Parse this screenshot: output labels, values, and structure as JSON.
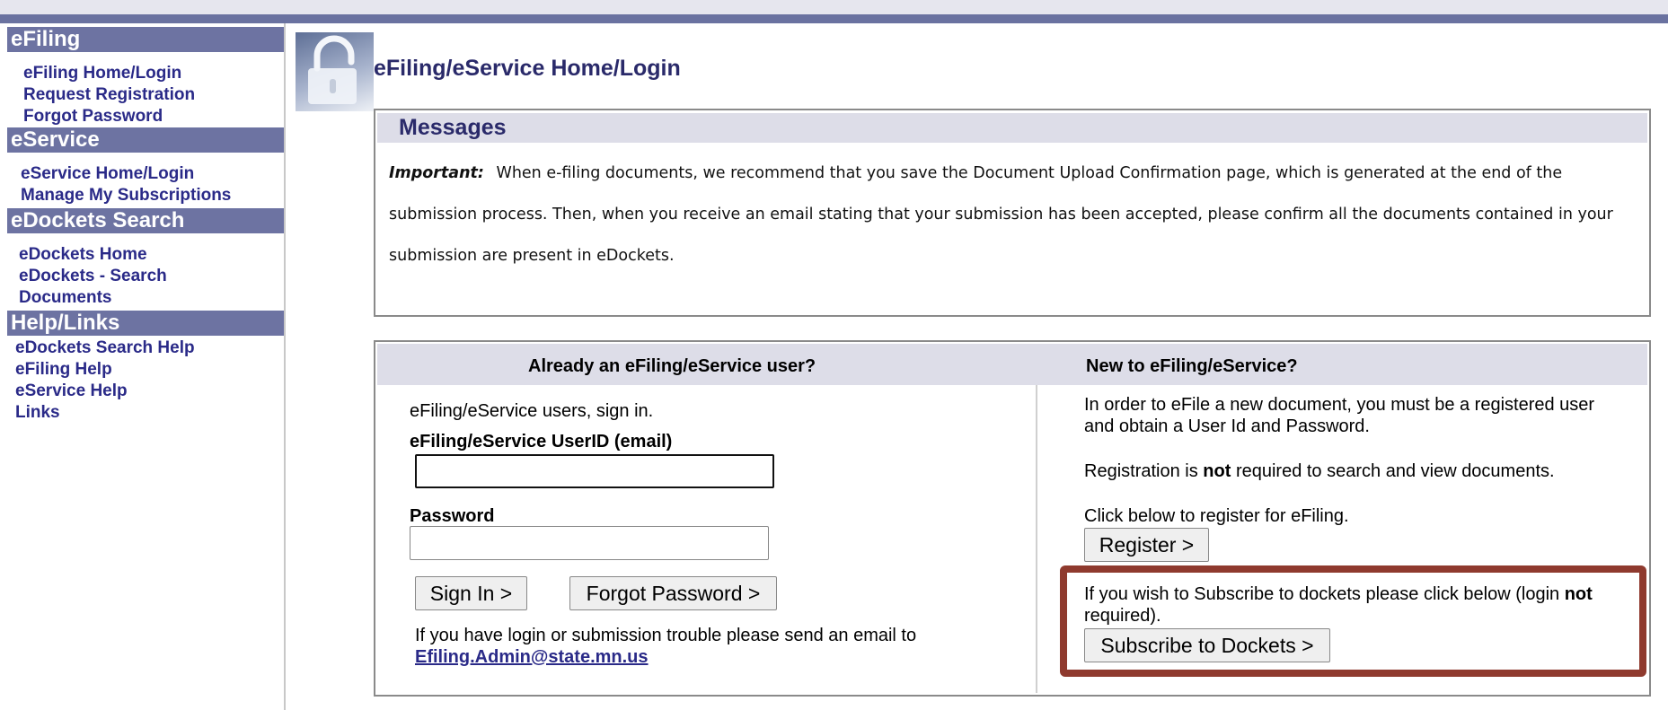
{
  "sidebar": {
    "efiling": {
      "heading": "eFiling",
      "links": [
        "eFiling Home/Login",
        "Request Registration",
        "Forgot Password"
      ]
    },
    "eservice": {
      "heading": "eService",
      "links": [
        "eService Home/Login",
        "Manage My Subscriptions"
      ]
    },
    "edockets": {
      "heading": "eDockets Search",
      "links": [
        "eDockets Home",
        "eDockets - Search",
        "Documents"
      ]
    },
    "help": {
      "heading": "Help/Links",
      "links": [
        "eDockets Search Help",
        "eFiling Help",
        "eService Help",
        "Links"
      ]
    }
  },
  "page_title": "eFiling/eService Home/Login",
  "messages": {
    "heading": "Messages",
    "important_label": "Important:",
    "line1": "When e-filing documents, we recommend that you save the Document Upload Confirmation page, which is generated at the end of the",
    "line2": "submission process. Then, when you receive an email stating that your submission has been accepted, please confirm all the documents contained in your",
    "line3": "submission are present in eDockets."
  },
  "login": {
    "heading": "Already an eFiling/eService user?",
    "intro": "eFiling/eService users, sign in.",
    "userid_label": "eFiling/eService UserID (email)",
    "userid_value": "",
    "password_label": "Password",
    "password_value": "",
    "sign_in_button": "Sign In >",
    "forgot_button": "Forgot Password >",
    "trouble_text": "If you have login or submission trouble please send an email to",
    "admin_email": "Efiling.Admin@state.mn.us"
  },
  "new_user": {
    "heading": "New to eFiling/eService?",
    "text1_line1": "In order to eFile a new document, you must be a registered user",
    "text1_line2": "and obtain a User Id and Password.",
    "reg_prefix": "Registration is",
    "reg_bold": "not",
    "reg_suffix": "required to search and view documents.",
    "click_text": "Click below to register for eFiling.",
    "register_button": "Register >",
    "subscribe_line1_prefix": "If you wish to Subscribe to dockets please click below (login",
    "subscribe_line1_bold": "not",
    "subscribe_line2": "required).",
    "subscribe_button": "Subscribe to Dockets >"
  },
  "colors": {
    "nav_header_bg": "#6d73a2",
    "link_color": "#2a2a88",
    "panel_header_bg": "#dddde8",
    "highlight_border": "#8f3a2e"
  }
}
